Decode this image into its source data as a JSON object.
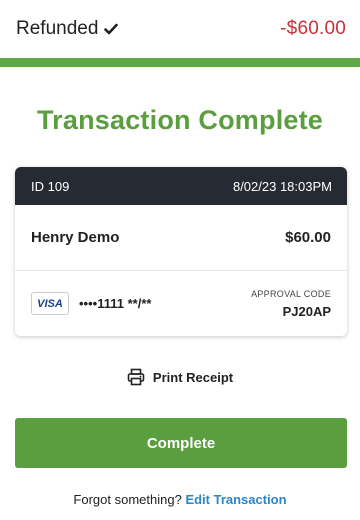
{
  "status": {
    "label": "Refunded",
    "icon": "check-icon",
    "amount": "-$60.00",
    "amount_color": "#c8313a"
  },
  "accent_color": "#5a9e3f",
  "title": "Transaction Complete",
  "transaction": {
    "id": "ID 109",
    "datetime": "8/02/23 18:03PM",
    "customer": "Henry Demo",
    "amount": "$60.00",
    "card_brand": "VISA",
    "card_masked": "••••1111 **/**",
    "approval_label": "APPROVAL CODE",
    "approval_code": "PJ20AP"
  },
  "actions": {
    "print_icon": "printer-icon",
    "print_label": "Print Receipt",
    "complete_label": "Complete"
  },
  "footer": {
    "prompt": "Forgot something?",
    "link": "Edit Transaction"
  }
}
